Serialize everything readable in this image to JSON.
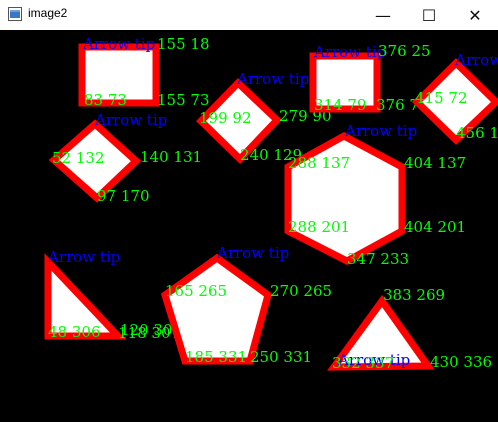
{
  "window": {
    "title": "image2",
    "controls": {
      "minimize": "—",
      "maximize": "☐",
      "close": "✕"
    }
  },
  "canvas": {
    "background": "#000000",
    "colors": {
      "shape_outline": "#ff0000",
      "shape_fill": "#ffffff",
      "coord_label": "#00ff00",
      "arrow_label": "#0000ff"
    },
    "shapes": [
      {
        "name": "square-1",
        "arrow": "Arrow tip",
        "coords": [
          "155 18",
          "83 73",
          "155 73"
        ]
      },
      {
        "name": "diamond-1",
        "arrow": "Arrow tip",
        "coords": [
          "199 92",
          "279 90",
          "240 129"
        ]
      },
      {
        "name": "square-2",
        "arrow": "Arrow tip",
        "coords": [
          "376 25",
          "314 79",
          "376 79"
        ]
      },
      {
        "name": "diamond-2",
        "arrow": "Arrow tip",
        "coords": [
          "415 72",
          "456 1"
        ]
      },
      {
        "name": "diamond-3",
        "arrow": "Arrow tip",
        "coords": [
          "52 132",
          "140 131",
          "97 170"
        ]
      },
      {
        "name": "hexagon",
        "arrow": "Arrow tip",
        "coords": [
          "288 137",
          "404 137",
          "288 201",
          "404 201",
          "347 233"
        ]
      },
      {
        "name": "triangle-right",
        "arrow": "Arrow tip",
        "coords": [
          "48 306",
          "120 306",
          "118 307"
        ]
      },
      {
        "name": "pentagon",
        "arrow": "Arrow tip",
        "coords": [
          "165 265",
          "270 265",
          "185 331",
          "250 331"
        ]
      },
      {
        "name": "triangle",
        "arrow": "Arrow tip",
        "coords": [
          "383 269",
          "332 337",
          "430 336"
        ]
      }
    ]
  }
}
